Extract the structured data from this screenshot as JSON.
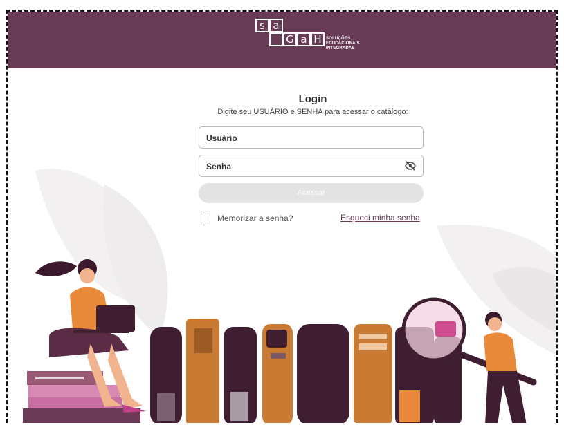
{
  "header": {
    "logo": {
      "letters_top": [
        "s",
        "a"
      ],
      "letters_bottom": [
        "G",
        "a",
        "H"
      ],
      "tagline": [
        "SOLUÇÕES",
        "EDUCACIONAIS",
        "INTEGRADAS"
      ]
    }
  },
  "login": {
    "title": "Login",
    "subtitle": "Digite seu USUÁRIO e SENHA para acessar o catálogo:",
    "username_label": "Usuário",
    "password_label": "Senha",
    "password_toggle_icon": "eye-off-icon",
    "submit_label": "Acessar",
    "remember_label": "Memorizar a senha?",
    "remember_checked": false,
    "forgot_label": "Esqueci minha senha"
  },
  "colors": {
    "header": "#673a55",
    "button_disabled": "#e3e3e3",
    "accent_orange": "#e98a3a",
    "book_dark": "#3e1e30"
  },
  "illustration": {
    "name": "reading-people-and-books",
    "items": [
      "woman-with-laptop",
      "book-stack",
      "row-of-books",
      "man-with-magnifying-glass",
      "magnifying-glass-icon"
    ]
  }
}
